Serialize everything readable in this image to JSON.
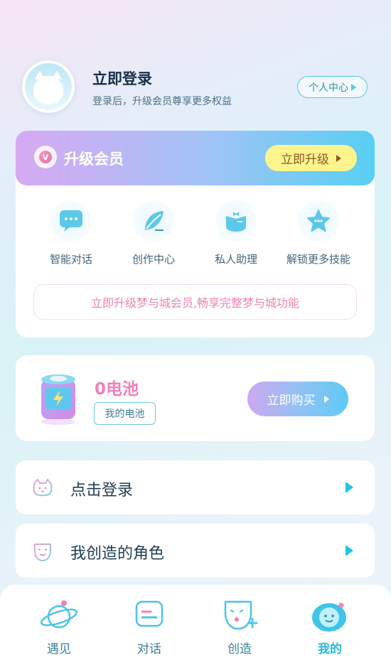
{
  "header": {
    "login_title": "立即登录",
    "login_subtitle": "登录后，升级会员尊享更多权益",
    "personal_center_label": "个人中心"
  },
  "vip": {
    "title": "升级会员",
    "upgrade_label": "立即升级",
    "features": [
      {
        "label": "智能对话",
        "icon": "chat-bubble-icon"
      },
      {
        "label": "创作中心",
        "icon": "leaf-pen-icon"
      },
      {
        "label": "私人助理",
        "icon": "bow-tie-icon"
      },
      {
        "label": "解锁更多技能",
        "icon": "star-icon"
      }
    ],
    "promo_text": "立即升级梦与城会员,畅享完整梦与城功能"
  },
  "battery": {
    "value_text": "0电池",
    "my_battery_label": "我的电池",
    "buy_label": "立即购买"
  },
  "menu": [
    {
      "label": "点击登录",
      "icon": "cat-face-icon"
    },
    {
      "label": "我创造的角色",
      "icon": "mask-icon"
    }
  ],
  "tabs": [
    {
      "label": "遇见",
      "icon": "planet-icon"
    },
    {
      "label": "对话",
      "icon": "message-icon"
    },
    {
      "label": "创造",
      "icon": "mask-plus-icon"
    },
    {
      "label": "我的",
      "icon": "smiley-icon",
      "active": true
    }
  ],
  "colors": {
    "accent": "#27b8dd",
    "pink": "#f17fbc",
    "upgrade_button": "#fdf48e"
  }
}
